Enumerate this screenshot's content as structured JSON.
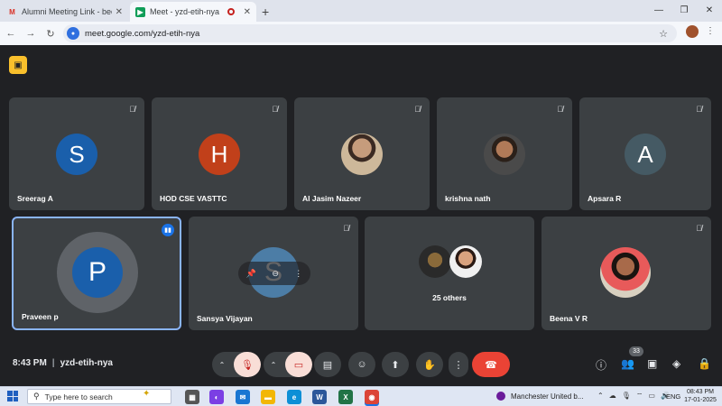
{
  "browser": {
    "tabs": [
      {
        "title": "Alumni Meeting Link - beena@",
        "favicon": "gmail-icon",
        "active": false
      },
      {
        "title": "Meet - yzd-etih-nya",
        "favicon": "meet-icon",
        "active": true,
        "recording": true
      }
    ],
    "url": "meet.google.com/yzd-etih-nya"
  },
  "meeting": {
    "top_row": [
      {
        "name": "Sreerag A",
        "initial": "S",
        "color": "#1a5fab",
        "muted": true
      },
      {
        "name": "HOD CSE VASTTC",
        "initial": "H",
        "color": "#c1401a",
        "muted": true
      },
      {
        "name": "Al Jasim Nazeer",
        "photo": true,
        "muted": true
      },
      {
        "name": "krishna nath",
        "photo": true,
        "muted": true
      },
      {
        "name": "Apsara R",
        "initial": "A",
        "color": "#455a64",
        "muted": true
      }
    ],
    "bottom_row": [
      {
        "name": "Praveen p",
        "initial": "P",
        "color": "#1a5fab",
        "speaking": true
      },
      {
        "name": "Sansya Vijayan",
        "initial": "S",
        "color": "#4f88b8",
        "muted": true
      },
      {
        "others_label": "25 others"
      },
      {
        "name": "Beena V R",
        "photo": true,
        "muted": true
      }
    ],
    "clock": "8:43 PM",
    "meeting_code": "yzd-etih-nya",
    "participant_count": "33"
  },
  "taskbar": {
    "search_placeholder": "Type here to search",
    "news": "Manchester United b...",
    "lang": "ENG",
    "time": "08:43 PM",
    "date": "17-01-2025"
  }
}
